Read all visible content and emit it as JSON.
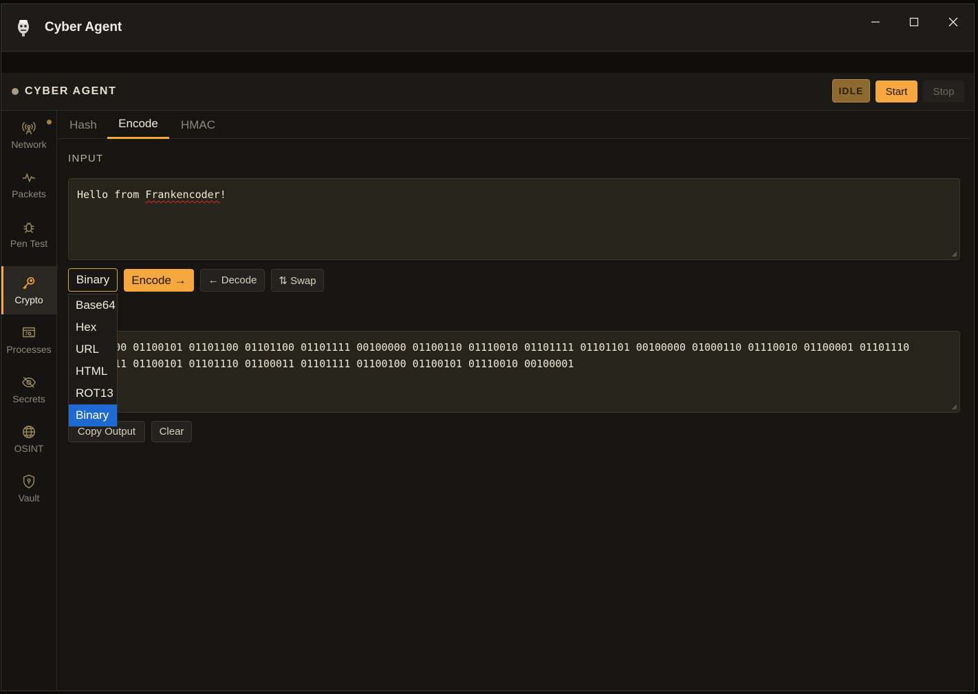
{
  "window": {
    "title": "Cyber Agent"
  },
  "header": {
    "brand": "CYBER AGENT",
    "status_badge": "IDLE",
    "start_label": "Start",
    "stop_label": "Stop"
  },
  "sidebar": {
    "items": [
      {
        "label": "Network",
        "icon": "antenna-icon"
      },
      {
        "label": "Packets",
        "icon": "pulse-icon"
      },
      {
        "label": "Pen Test",
        "icon": "bug-icon"
      },
      {
        "label": "Crypto",
        "icon": "key-icon",
        "active": true
      },
      {
        "label": "Processes",
        "icon": "process-icon"
      },
      {
        "label": "Secrets",
        "icon": "eye-off-icon"
      },
      {
        "label": "OSINT",
        "icon": "globe-icon"
      },
      {
        "label": "Vault",
        "icon": "shield-icon"
      }
    ]
  },
  "tabs": [
    {
      "label": "Hash"
    },
    {
      "label": "Encode",
      "active": true
    },
    {
      "label": "HMAC"
    }
  ],
  "encode": {
    "input_label": "INPUT",
    "input_prefix": "Hello from ",
    "input_misspelled": "Frankencoder",
    "input_suffix": "!",
    "encoding_selected": "Binary",
    "encode_label": "Encode →",
    "decode_label": "← Decode",
    "swap_label": "⇅ Swap",
    "encoding_options": [
      "Base64",
      "Hex",
      "URL",
      "HTML",
      "ROT13",
      "Binary"
    ],
    "output_line1": "01001000 01100101 01101100 01101100 01101111 00100000 01100110 01110010 01101111 01101101 00100000 01000110 01110010 01100001 01101110",
    "output_line2": "01101011 01100101 01101110 01100011 01101111 01100100 01100101 01110010 00100001",
    "copy_label": "Copy Output",
    "clear_label": "Clear"
  },
  "colors": {
    "accent": "#f5a83f",
    "selection": "#1e69d2",
    "badge": "#8e6a30"
  }
}
